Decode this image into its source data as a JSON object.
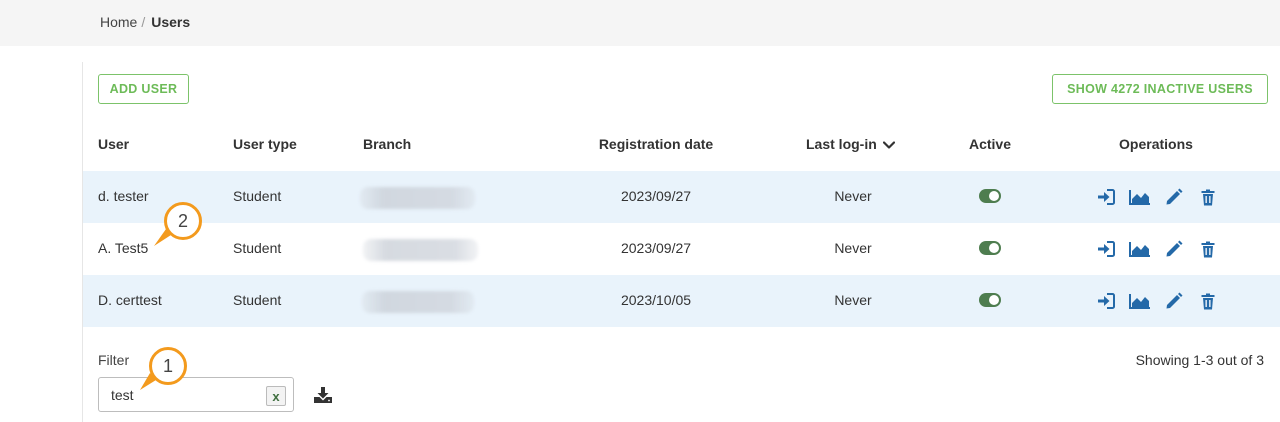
{
  "breadcrumb": {
    "home": "Home",
    "separator": "/",
    "current": "Users"
  },
  "buttons": {
    "add_user": "ADD USER",
    "show_inactive": "SHOW 4272 INACTIVE USERS"
  },
  "table": {
    "columns": [
      "User",
      "User type",
      "Branch",
      "Registration date",
      "Last log-in",
      "Active",
      "Operations"
    ],
    "sort_column": "Last log-in",
    "rows": [
      {
        "user": "d. tester",
        "type": "Student",
        "registration": "2023/09/27",
        "last_login": "Never",
        "active": true
      },
      {
        "user": "A. Test5",
        "type": "Student",
        "registration": "2023/09/27",
        "last_login": "Never",
        "active": true
      },
      {
        "user": "D. certtest",
        "type": "Student",
        "registration": "2023/10/05",
        "last_login": "Never",
        "active": true
      }
    ],
    "operations": [
      "login-as-icon",
      "stats-icon",
      "edit-icon",
      "delete-icon"
    ]
  },
  "filter": {
    "label": "Filter",
    "value": "test",
    "clear_label": "x"
  },
  "pagination": {
    "showing": "Showing 1-3 out of 3"
  },
  "callouts": {
    "one": "1",
    "two": "2"
  },
  "colors": {
    "accent_green": "#6dbb58",
    "icon_blue": "#2469a8",
    "toggle_on": "#4e7d4f",
    "row_alt": "#e9f3fb",
    "callout_orange": "#f39a1d"
  }
}
